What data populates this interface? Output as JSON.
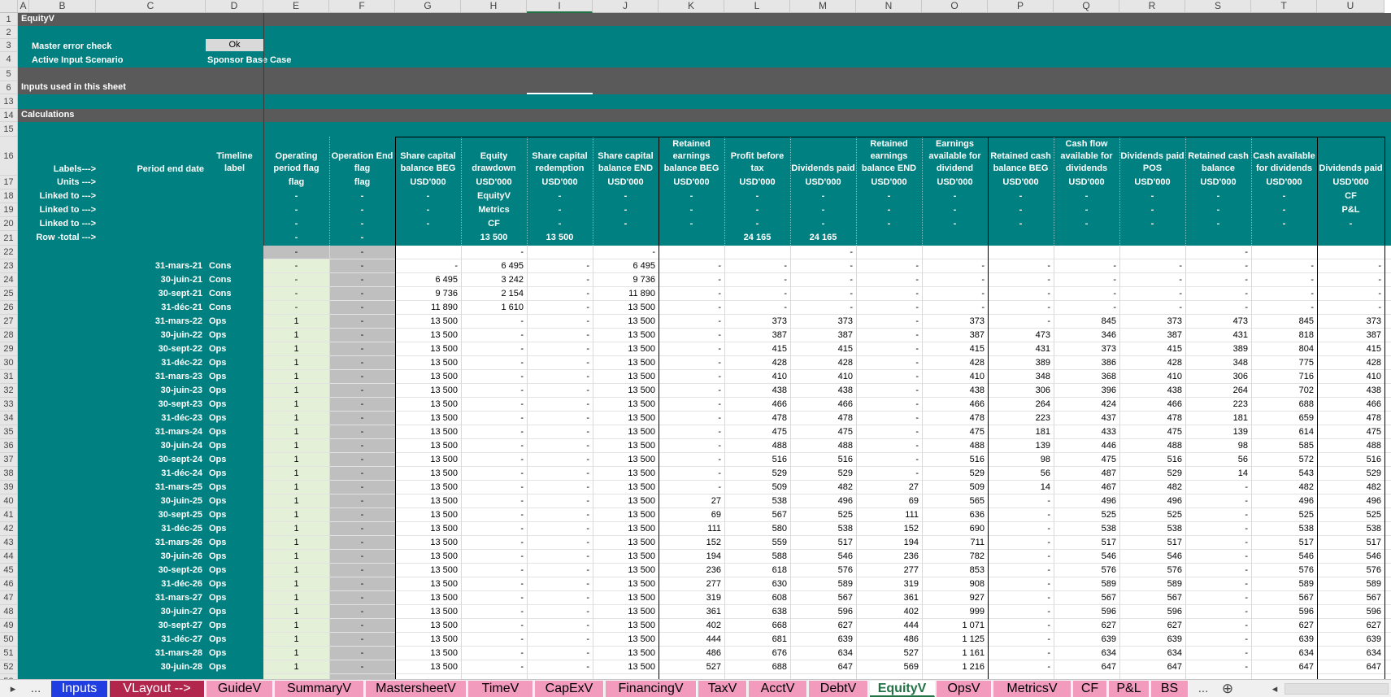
{
  "workbook": {
    "sheet_title": "EquityV",
    "columns": [
      "A",
      "B",
      "C",
      "D",
      "E",
      "F",
      "G",
      "H",
      "I",
      "J",
      "K",
      "L",
      "M",
      "N",
      "O",
      "P",
      "Q",
      "R",
      "S",
      "T",
      "U"
    ],
    "sections": {
      "master_error_label": "Master error check",
      "master_error_value": "Ok",
      "scenario_label": "Active Input Scenario",
      "scenario_value": "Sponsor Base Case",
      "inputs_title": "Inputs used in this sheet",
      "calc_title": "Calculations"
    },
    "row_labels": {
      "labels": "Labels--->",
      "units": "Units --->",
      "linked1": "Linked to --->",
      "linked2": "Linked to --->",
      "linked3": "Linked to --->",
      "rowtotal": "Row -total --->",
      "period_end": "Period end date",
      "timeline": "Timeline label"
    },
    "headers": [
      {
        "col": "E",
        "label": "Operating period flag",
        "units": "flag",
        "l1": "-",
        "l2": "-",
        "l3": "-",
        "total": "-"
      },
      {
        "col": "F",
        "label": "Operation End flag",
        "units": "flag",
        "l1": "-",
        "l2": "-",
        "l3": "-",
        "total": "-"
      },
      {
        "col": "G",
        "label": "Share capital balance BEG",
        "units": "USD'000",
        "l1": "-",
        "l2": "-",
        "l3": "-",
        "total": ""
      },
      {
        "col": "H",
        "label": "Equity drawdown",
        "units": "USD'000",
        "l1": "EquityV",
        "l2": "Metrics",
        "l3": "CF",
        "total": "13 500"
      },
      {
        "col": "I",
        "label": "Share capital redemption",
        "units": "USD'000",
        "l1": "-",
        "l2": "-",
        "l3": "-",
        "total": "13 500"
      },
      {
        "col": "J",
        "label": "Share capital balance END",
        "units": "USD'000",
        "l1": "-",
        "l2": "-",
        "l3": "-",
        "total": ""
      },
      {
        "col": "K",
        "label": "Retained earnings balance BEG",
        "units": "USD'000",
        "l1": "-",
        "l2": "-",
        "l3": "-",
        "total": ""
      },
      {
        "col": "L",
        "label": "Profit before tax",
        "units": "USD'000",
        "l1": "-",
        "l2": "-",
        "l3": "-",
        "total": "24 165"
      },
      {
        "col": "M",
        "label": "Dividends paid",
        "units": "USD'000",
        "l1": "-",
        "l2": "-",
        "l3": "-",
        "total": "24 165"
      },
      {
        "col": "N",
        "label": "Retained earnings balance END",
        "units": "USD'000",
        "l1": "-",
        "l2": "-",
        "l3": "-",
        "total": ""
      },
      {
        "col": "O",
        "label": "Earnings available for dividend",
        "units": "USD'000",
        "l1": "-",
        "l2": "-",
        "l3": "-",
        "total": ""
      },
      {
        "col": "P",
        "label": "Retained cash balance BEG",
        "units": "USD'000",
        "l1": "-",
        "l2": "-",
        "l3": "-",
        "total": ""
      },
      {
        "col": "Q",
        "label": "Cash flow available for dividends",
        "units": "USD'000",
        "l1": "-",
        "l2": "-",
        "l3": "-",
        "total": ""
      },
      {
        "col": "R",
        "label": "Dividends paid POS",
        "units": "USD'000",
        "l1": "-",
        "l2": "-",
        "l3": "-",
        "total": ""
      },
      {
        "col": "S",
        "label": "Retained cash balance",
        "units": "USD'000",
        "l1": "-",
        "l2": "-",
        "l3": "-",
        "total": ""
      },
      {
        "col": "T",
        "label": "Cash available for dividends",
        "units": "USD'000",
        "l1": "-",
        "l2": "-",
        "l3": "-",
        "total": ""
      },
      {
        "col": "U",
        "label": "Dividends paid",
        "units": "USD'000",
        "l1": "CF",
        "l2": "P&L",
        "l3": "-",
        "total": ""
      }
    ],
    "row22": [
      "-",
      "-",
      "",
      "-",
      "",
      "-",
      "",
      "",
      "-",
      "",
      "",
      "",
      "",
      "",
      "-",
      "",
      ""
    ],
    "rows": [
      {
        "n": "23",
        "date": "31-mars-21",
        "tl": "Cons",
        "v": [
          "-",
          "-",
          "-",
          "6 495",
          "-",
          "6 495",
          "-",
          "-",
          "-",
          "-",
          "-",
          "-",
          "-",
          "-",
          "-",
          "-",
          "-"
        ]
      },
      {
        "n": "24",
        "date": "30-juin-21",
        "tl": "Cons",
        "v": [
          "-",
          "-",
          "6 495",
          "3 242",
          "-",
          "9 736",
          "-",
          "-",
          "-",
          "-",
          "-",
          "-",
          "-",
          "-",
          "-",
          "-",
          "-"
        ]
      },
      {
        "n": "25",
        "date": "30-sept-21",
        "tl": "Cons",
        "v": [
          "-",
          "-",
          "9 736",
          "2 154",
          "-",
          "11 890",
          "-",
          "-",
          "-",
          "-",
          "-",
          "-",
          "-",
          "-",
          "-",
          "-",
          "-"
        ]
      },
      {
        "n": "26",
        "date": "31-déc-21",
        "tl": "Cons",
        "v": [
          "-",
          "-",
          "11 890",
          "1 610",
          "-",
          "13 500",
          "-",
          "-",
          "-",
          "-",
          "-",
          "-",
          "-",
          "-",
          "-",
          "-",
          "-"
        ]
      },
      {
        "n": "27",
        "date": "31-mars-22",
        "tl": "Ops",
        "v": [
          "1",
          "-",
          "13 500",
          "-",
          "-",
          "13 500",
          "-",
          "373",
          "373",
          "-",
          "373",
          "-",
          "845",
          "373",
          "473",
          "845",
          "373"
        ]
      },
      {
        "n": "28",
        "date": "30-juin-22",
        "tl": "Ops",
        "v": [
          "1",
          "-",
          "13 500",
          "-",
          "-",
          "13 500",
          "-",
          "387",
          "387",
          "-",
          "387",
          "473",
          "346",
          "387",
          "431",
          "818",
          "387"
        ]
      },
      {
        "n": "29",
        "date": "30-sept-22",
        "tl": "Ops",
        "v": [
          "1",
          "-",
          "13 500",
          "-",
          "-",
          "13 500",
          "-",
          "415",
          "415",
          "-",
          "415",
          "431",
          "373",
          "415",
          "389",
          "804",
          "415"
        ]
      },
      {
        "n": "30",
        "date": "31-déc-22",
        "tl": "Ops",
        "v": [
          "1",
          "-",
          "13 500",
          "-",
          "-",
          "13 500",
          "-",
          "428",
          "428",
          "-",
          "428",
          "389",
          "386",
          "428",
          "348",
          "775",
          "428"
        ]
      },
      {
        "n": "31",
        "date": "31-mars-23",
        "tl": "Ops",
        "v": [
          "1",
          "-",
          "13 500",
          "-",
          "-",
          "13 500",
          "-",
          "410",
          "410",
          "-",
          "410",
          "348",
          "368",
          "410",
          "306",
          "716",
          "410"
        ]
      },
      {
        "n": "32",
        "date": "30-juin-23",
        "tl": "Ops",
        "v": [
          "1",
          "-",
          "13 500",
          "-",
          "-",
          "13 500",
          "-",
          "438",
          "438",
          "-",
          "438",
          "306",
          "396",
          "438",
          "264",
          "702",
          "438"
        ]
      },
      {
        "n": "33",
        "date": "30-sept-23",
        "tl": "Ops",
        "v": [
          "1",
          "-",
          "13 500",
          "-",
          "-",
          "13 500",
          "-",
          "466",
          "466",
          "-",
          "466",
          "264",
          "424",
          "466",
          "223",
          "688",
          "466"
        ]
      },
      {
        "n": "34",
        "date": "31-déc-23",
        "tl": "Ops",
        "v": [
          "1",
          "-",
          "13 500",
          "-",
          "-",
          "13 500",
          "-",
          "478",
          "478",
          "-",
          "478",
          "223",
          "437",
          "478",
          "181",
          "659",
          "478"
        ]
      },
      {
        "n": "35",
        "date": "31-mars-24",
        "tl": "Ops",
        "v": [
          "1",
          "-",
          "13 500",
          "-",
          "-",
          "13 500",
          "-",
          "475",
          "475",
          "-",
          "475",
          "181",
          "433",
          "475",
          "139",
          "614",
          "475"
        ]
      },
      {
        "n": "36",
        "date": "30-juin-24",
        "tl": "Ops",
        "v": [
          "1",
          "-",
          "13 500",
          "-",
          "-",
          "13 500",
          "-",
          "488",
          "488",
          "-",
          "488",
          "139",
          "446",
          "488",
          "98",
          "585",
          "488"
        ]
      },
      {
        "n": "37",
        "date": "30-sept-24",
        "tl": "Ops",
        "v": [
          "1",
          "-",
          "13 500",
          "-",
          "-",
          "13 500",
          "-",
          "516",
          "516",
          "-",
          "516",
          "98",
          "475",
          "516",
          "56",
          "572",
          "516"
        ]
      },
      {
        "n": "38",
        "date": "31-déc-24",
        "tl": "Ops",
        "v": [
          "1",
          "-",
          "13 500",
          "-",
          "-",
          "13 500",
          "-",
          "529",
          "529",
          "-",
          "529",
          "56",
          "487",
          "529",
          "14",
          "543",
          "529"
        ]
      },
      {
        "n": "39",
        "date": "31-mars-25",
        "tl": "Ops",
        "v": [
          "1",
          "-",
          "13 500",
          "-",
          "-",
          "13 500",
          "-",
          "509",
          "482",
          "27",
          "509",
          "14",
          "467",
          "482",
          "-",
          "482",
          "482"
        ]
      },
      {
        "n": "40",
        "date": "30-juin-25",
        "tl": "Ops",
        "v": [
          "1",
          "-",
          "13 500",
          "-",
          "-",
          "13 500",
          "27",
          "538",
          "496",
          "69",
          "565",
          "-",
          "496",
          "496",
          "-",
          "496",
          "496"
        ]
      },
      {
        "n": "41",
        "date": "30-sept-25",
        "tl": "Ops",
        "v": [
          "1",
          "-",
          "13 500",
          "-",
          "-",
          "13 500",
          "69",
          "567",
          "525",
          "111",
          "636",
          "-",
          "525",
          "525",
          "-",
          "525",
          "525"
        ]
      },
      {
        "n": "42",
        "date": "31-déc-25",
        "tl": "Ops",
        "v": [
          "1",
          "-",
          "13 500",
          "-",
          "-",
          "13 500",
          "111",
          "580",
          "538",
          "152",
          "690",
          "-",
          "538",
          "538",
          "-",
          "538",
          "538"
        ]
      },
      {
        "n": "43",
        "date": "31-mars-26",
        "tl": "Ops",
        "v": [
          "1",
          "-",
          "13 500",
          "-",
          "-",
          "13 500",
          "152",
          "559",
          "517",
          "194",
          "711",
          "-",
          "517",
          "517",
          "-",
          "517",
          "517"
        ]
      },
      {
        "n": "44",
        "date": "30-juin-26",
        "tl": "Ops",
        "v": [
          "1",
          "-",
          "13 500",
          "-",
          "-",
          "13 500",
          "194",
          "588",
          "546",
          "236",
          "782",
          "-",
          "546",
          "546",
          "-",
          "546",
          "546"
        ]
      },
      {
        "n": "45",
        "date": "30-sept-26",
        "tl": "Ops",
        "v": [
          "1",
          "-",
          "13 500",
          "-",
          "-",
          "13 500",
          "236",
          "618",
          "576",
          "277",
          "853",
          "-",
          "576",
          "576",
          "-",
          "576",
          "576"
        ]
      },
      {
        "n": "46",
        "date": "31-déc-26",
        "tl": "Ops",
        "v": [
          "1",
          "-",
          "13 500",
          "-",
          "-",
          "13 500",
          "277",
          "630",
          "589",
          "319",
          "908",
          "-",
          "589",
          "589",
          "-",
          "589",
          "589"
        ]
      },
      {
        "n": "47",
        "date": "31-mars-27",
        "tl": "Ops",
        "v": [
          "1",
          "-",
          "13 500",
          "-",
          "-",
          "13 500",
          "319",
          "608",
          "567",
          "361",
          "927",
          "-",
          "567",
          "567",
          "-",
          "567",
          "567"
        ]
      },
      {
        "n": "48",
        "date": "30-juin-27",
        "tl": "Ops",
        "v": [
          "1",
          "-",
          "13 500",
          "-",
          "-",
          "13 500",
          "361",
          "638",
          "596",
          "402",
          "999",
          "-",
          "596",
          "596",
          "-",
          "596",
          "596"
        ]
      },
      {
        "n": "49",
        "date": "30-sept-27",
        "tl": "Ops",
        "v": [
          "1",
          "-",
          "13 500",
          "-",
          "-",
          "13 500",
          "402",
          "668",
          "627",
          "444",
          "1 071",
          "-",
          "627",
          "627",
          "-",
          "627",
          "627"
        ]
      },
      {
        "n": "50",
        "date": "31-déc-27",
        "tl": "Ops",
        "v": [
          "1",
          "-",
          "13 500",
          "-",
          "-",
          "13 500",
          "444",
          "681",
          "639",
          "486",
          "1 125",
          "-",
          "639",
          "639",
          "-",
          "639",
          "639"
        ]
      },
      {
        "n": "51",
        "date": "31-mars-28",
        "tl": "Ops",
        "v": [
          "1",
          "-",
          "13 500",
          "-",
          "-",
          "13 500",
          "486",
          "676",
          "634",
          "527",
          "1 161",
          "-",
          "634",
          "634",
          "-",
          "634",
          "634"
        ]
      },
      {
        "n": "52",
        "date": "30-juin-28",
        "tl": "Ops",
        "v": [
          "1",
          "-",
          "13 500",
          "-",
          "-",
          "13 500",
          "527",
          "688",
          "647",
          "569",
          "1 216",
          "-",
          "647",
          "647",
          "-",
          "647",
          "647"
        ]
      }
    ],
    "row_numbers_top": {
      "r1": "1",
      "r2": "2",
      "r3": "3",
      "r4": "4",
      "r5": "5",
      "r6": "6",
      "r13": "13",
      "r14": "14",
      "r15": "15",
      "r16": "16",
      "r17": "17",
      "r18": "18",
      "r19": "19",
      "r20": "20",
      "r21": "21",
      "r22": "22",
      "r53": "53"
    }
  },
  "tabs": {
    "nav_prev": "▸",
    "nav_more_left": "...",
    "items": [
      {
        "label": "Inputs",
        "style": "blue"
      },
      {
        "label": "VLayout -->",
        "style": "maroon"
      },
      {
        "label": "GuideV",
        "style": "pink"
      },
      {
        "label": "SummaryV",
        "style": "pink"
      },
      {
        "label": "MastersheetV",
        "style": "pink"
      },
      {
        "label": "TimeV",
        "style": "pink"
      },
      {
        "label": "CapExV",
        "style": "pink"
      },
      {
        "label": "FinancingV",
        "style": "pink"
      },
      {
        "label": "TaxV",
        "style": "pink"
      },
      {
        "label": "AcctV",
        "style": "pink"
      },
      {
        "label": "DebtV",
        "style": "pink"
      },
      {
        "label": "EquityV",
        "style": "active"
      },
      {
        "label": "OpsV",
        "style": "pink"
      },
      {
        "label": "MetricsV",
        "style": "pink"
      },
      {
        "label": "CF",
        "style": "pink"
      },
      {
        "label": "P&L",
        "style": "pink"
      },
      {
        "label": "BS",
        "style": "pink"
      }
    ],
    "nav_more_right": "...",
    "add_icon": "⊕",
    "scroll_left": "◂"
  }
}
